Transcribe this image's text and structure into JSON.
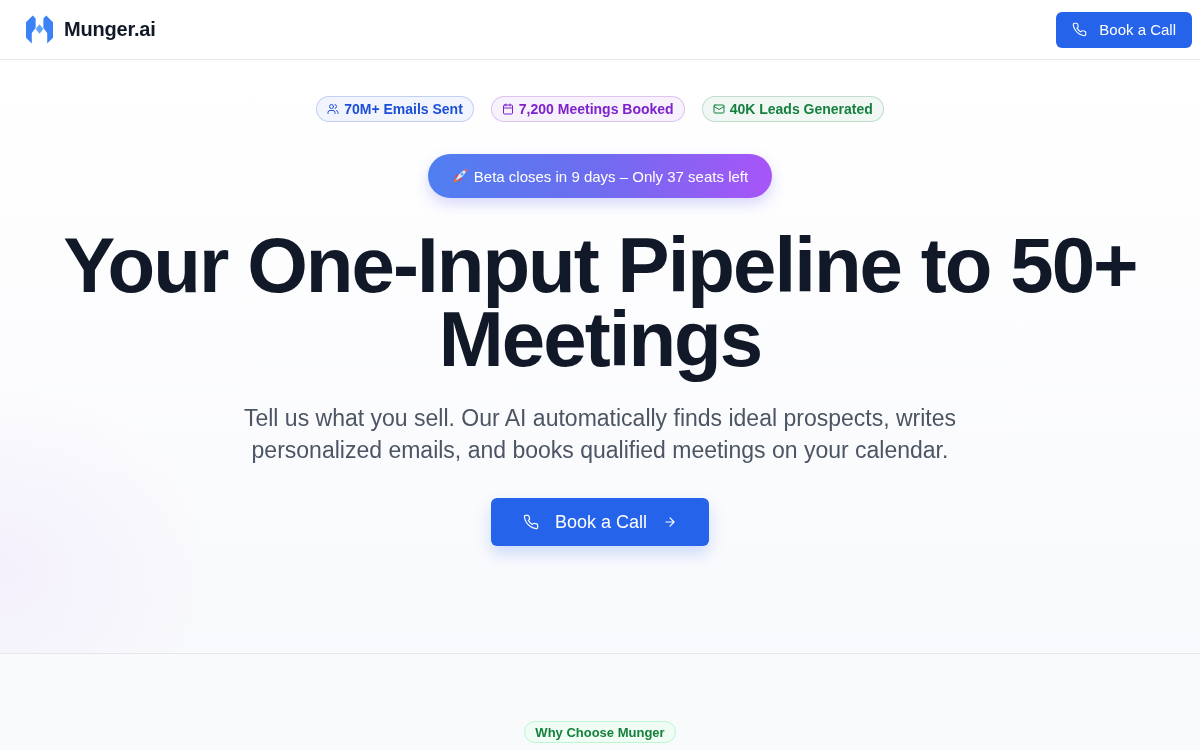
{
  "header": {
    "brand": "Munger.ai",
    "cta": {
      "label": "Book a Call"
    }
  },
  "hero": {
    "stats": [
      {
        "kind": "users",
        "label": "70M+ Emails Sent",
        "color": "#1d4ed8"
      },
      {
        "kind": "calendar",
        "label": "7,200 Meetings Booked",
        "color": "#7e22ce"
      },
      {
        "kind": "mail",
        "label": "40K Leads Generated",
        "color": "#15803d"
      }
    ],
    "announcement": "Beta closes in 9 days – Only 37 seats left",
    "title": "Your One-Input Pipeline to 50+ Meetings",
    "subtitle": "Tell us what you sell. Our AI automatically finds ideal prospects, writes personalized emails, and books qualified meetings on your calendar.",
    "cta": {
      "label": "Book a Call"
    }
  },
  "features": {
    "badge": "Why Choose Munger"
  }
}
